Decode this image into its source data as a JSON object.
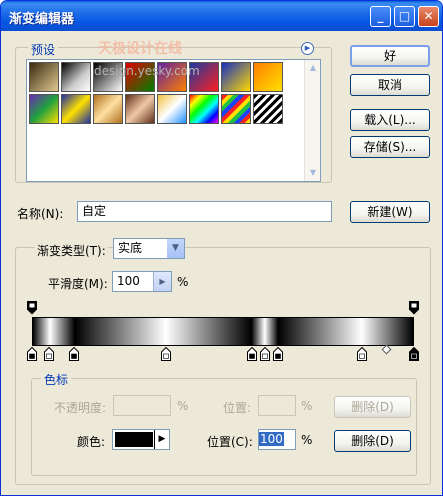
{
  "window": {
    "title": "渐变编辑器",
    "controls": [
      "_",
      "□",
      "✕"
    ]
  },
  "presets": {
    "legend": "预设",
    "menu_icon": "arrow-right-circle-icon",
    "watermark_cn": "天极设计在线",
    "watermark_url": "design.yesky.com"
  },
  "buttons": {
    "ok": "好",
    "cancel": "取消",
    "load": "载入(L)...",
    "save": "存储(S)...",
    "new": "新建(W)",
    "delete_opacity": "删除(D)",
    "delete_color": "删除(D)"
  },
  "name_field": {
    "label": "名称(N):",
    "value": "自定"
  },
  "gradient_type": {
    "label": "渐变类型(T):",
    "value": "实底"
  },
  "smoothness": {
    "label": "平滑度(M):",
    "value": "100",
    "unit": "%"
  },
  "gradient": {
    "opacity_stops": [
      0.0,
      1.0
    ],
    "color_stops": [
      {
        "pos": 0.0,
        "color": "#000000"
      },
      {
        "pos": 0.045,
        "color": "#ffffff"
      },
      {
        "pos": 0.11,
        "color": "#000000"
      },
      {
        "pos": 0.35,
        "color": "#ffffff"
      },
      {
        "pos": 0.575,
        "color": "#000000"
      },
      {
        "pos": 0.61,
        "color": "#ffffff"
      },
      {
        "pos": 0.645,
        "color": "#000000"
      },
      {
        "pos": 0.865,
        "color": "#ffffff"
      },
      {
        "pos": 1.0,
        "color": "#000000"
      }
    ],
    "midpoint": 0.93
  },
  "color_stop_section": {
    "legend": "色标",
    "opacity_label": "不透明度:",
    "opacity_unit": "%",
    "location_label_disabled": "位置:",
    "location_unit_disabled": "%",
    "color_label": "颜色:",
    "location_label": "位置(C):",
    "location_value": "100",
    "location_unit": "%"
  },
  "colors": {
    "title_bar": "#0a55e0",
    "dialog_bg": "#ece9d8",
    "legend_text": "#003ab5",
    "selected_color": "#000000"
  }
}
